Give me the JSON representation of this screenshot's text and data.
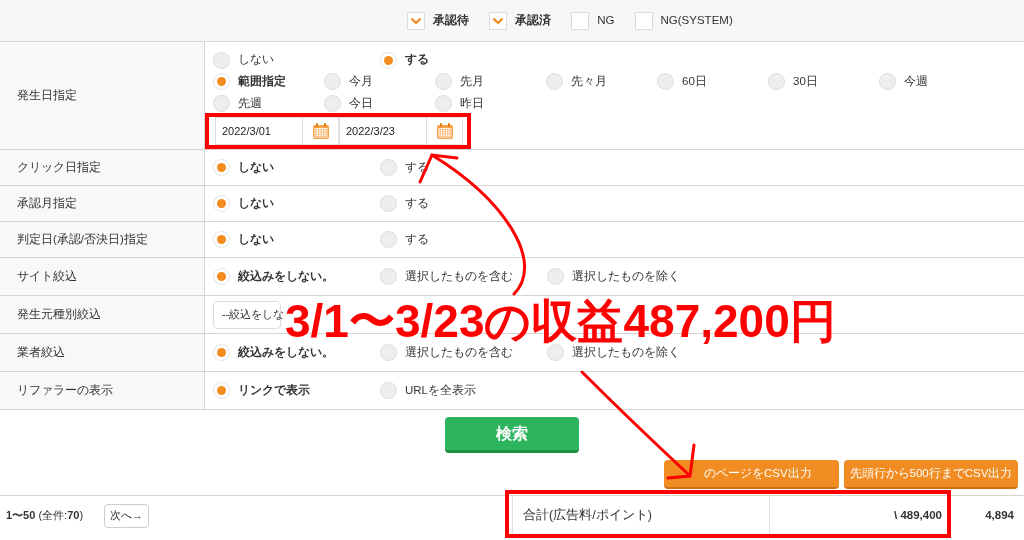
{
  "status_filters": [
    {
      "label": "承認待",
      "checked": true
    },
    {
      "label": "承認済",
      "checked": true
    },
    {
      "label": "NG",
      "checked": false
    },
    {
      "label": "NG(SYSTEM)",
      "checked": false
    }
  ],
  "occurrence_date": {
    "label": "発生日指定",
    "options": [
      {
        "label": "しない",
        "selected": false
      },
      {
        "label": "する",
        "selected": true
      }
    ],
    "periods": [
      {
        "label": "範囲指定",
        "selected": true
      },
      {
        "label": "今月",
        "selected": false
      },
      {
        "label": "先月",
        "selected": false
      },
      {
        "label": "先々月",
        "selected": false
      },
      {
        "label": "60日",
        "selected": false
      },
      {
        "label": "30日",
        "selected": false
      },
      {
        "label": "今週",
        "selected": false
      },
      {
        "label": "先週",
        "selected": false
      },
      {
        "label": "今日",
        "selected": false
      },
      {
        "label": "昨日",
        "selected": false
      }
    ],
    "date_range": [
      {
        "value": "2022/3/01"
      },
      {
        "value": "2022/3/23"
      }
    ]
  },
  "rows": [
    {
      "label": "クリック日指定",
      "kind": "radio",
      "options": [
        {
          "label": "しない",
          "selected": true
        },
        {
          "label": "する",
          "selected": false
        }
      ]
    },
    {
      "label": "承認月指定",
      "kind": "radio",
      "options": [
        {
          "label": "しない",
          "selected": true
        },
        {
          "label": "する",
          "selected": false
        }
      ]
    },
    {
      "label": "判定日(承認/否決日)指定",
      "kind": "radio",
      "options": [
        {
          "label": "しない",
          "selected": true
        },
        {
          "label": "する",
          "selected": false
        }
      ]
    },
    {
      "label": "サイト絞込",
      "kind": "radio",
      "options": [
        {
          "label": "絞込みをしない。",
          "selected": true
        },
        {
          "label": "選択したものを含む",
          "selected": false
        },
        {
          "label": "選択したものを除く",
          "selected": false
        }
      ]
    },
    {
      "label": "発生元種別絞込",
      "kind": "select",
      "value": "--絞込をしな"
    },
    {
      "label": "業者絞込",
      "kind": "radio",
      "options": [
        {
          "label": "絞込みをしない。",
          "selected": true
        },
        {
          "label": "選択したものを含む",
          "selected": false
        },
        {
          "label": "選択したものを除く",
          "selected": false
        }
      ]
    },
    {
      "label": "リファラーの表示",
      "kind": "radio",
      "options": [
        {
          "label": "リンクで表示",
          "selected": true
        },
        {
          "label": "URLを全表示",
          "selected": false
        }
      ]
    }
  ],
  "search_button": "検索",
  "csv_buttons": [
    "のページをCSV出力",
    "先頭行から500行までCSV出力"
  ],
  "pagination": {
    "range": "**1〜50** (全件:**70**)",
    "next": "次へ→"
  },
  "totals": {
    "label": "合計(広告料/ポイント)",
    "amount": "\\ 489,400",
    "count": "4,894"
  },
  "annotation": {
    "text": "3/1〜3/23の収益487,200円"
  }
}
